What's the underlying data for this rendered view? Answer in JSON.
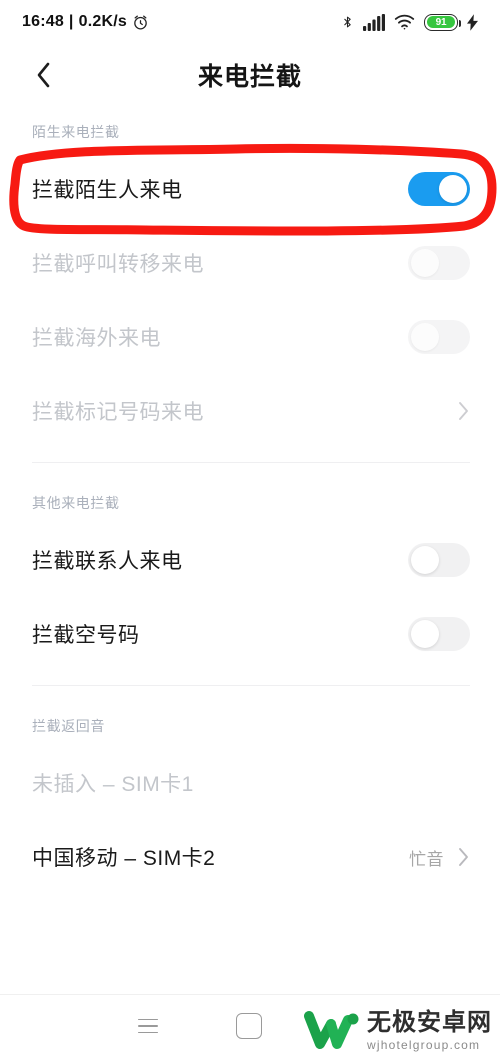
{
  "status_bar": {
    "time": "16:48",
    "separator": "|",
    "network_speed": "0.2K/s",
    "alarm_icon": "alarm-clock-icon",
    "bluetooth_icon": "bluetooth-icon",
    "signal_icon": "cellular-signal-icon",
    "wifi_icon": "wifi-icon",
    "battery_level": "91",
    "battery_percent": 91,
    "charging_icon": "lightning-bolt-icon",
    "battery_color": "#36c63f"
  },
  "header": {
    "back_icon": "chevron-left-icon",
    "title": "来电拦截"
  },
  "sections": [
    {
      "header": "陌生来电拦截",
      "rows": [
        {
          "label": "拦截陌生人来电",
          "control": "toggle",
          "state": "on",
          "disabled": false,
          "highlighted": true
        },
        {
          "label": "拦截呼叫转移来电",
          "control": "toggle",
          "state": "off",
          "disabled": true,
          "highlighted": false
        },
        {
          "label": "拦截海外来电",
          "control": "toggle",
          "state": "off",
          "disabled": true,
          "highlighted": false
        },
        {
          "label": "拦截标记号码来电",
          "control": "chevron",
          "value": "",
          "disabled": true,
          "highlighted": false
        }
      ]
    },
    {
      "header": "其他来电拦截",
      "rows": [
        {
          "label": "拦截联系人来电",
          "control": "toggle",
          "state": "off",
          "disabled": false,
          "highlighted": false
        },
        {
          "label": "拦截空号码",
          "control": "toggle",
          "state": "off",
          "disabled": false,
          "highlighted": false
        }
      ]
    },
    {
      "header": "拦截返回音",
      "rows": [
        {
          "label": "未插入 – SIM卡1",
          "control": "none",
          "value": "",
          "disabled": true,
          "highlighted": false
        },
        {
          "label": "中国移动 – SIM卡2",
          "control": "chevron",
          "value": "忙音",
          "disabled": false,
          "highlighted": false
        }
      ]
    }
  ],
  "annotation": {
    "type": "red-rectangle-highlight",
    "color": "#f71a12",
    "targets_row": "拦截陌生人来电"
  },
  "nav_bar": {
    "menu_icon": "hamburger-menu-icon",
    "home_icon": "square-home-icon"
  },
  "watermark": {
    "logo_icon": "w-logo-icon",
    "brand": "无极安卓网",
    "domain": "wjhotelgroup.com",
    "brand_color": "#1ba24a"
  },
  "theme": {
    "accent_on": "#1a9cf0",
    "toggle_off": "#f1f1f2",
    "text_primary": "#1a1a1a",
    "text_disabled": "#c3c6cb",
    "section_header": "#aab0bb"
  }
}
